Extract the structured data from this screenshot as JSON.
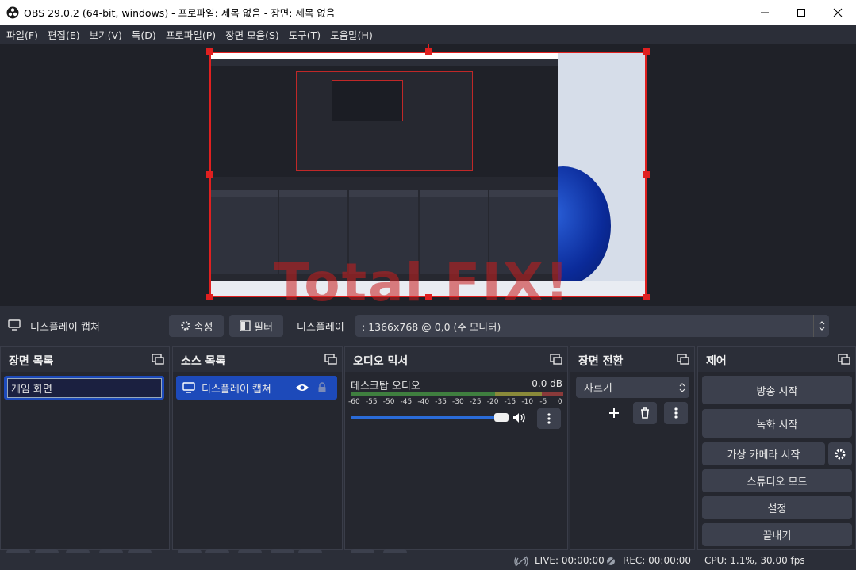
{
  "window": {
    "title": "OBS 29.0.2 (64-bit, windows) - 프로파일: 제목 없음 - 장면: 제목 없음"
  },
  "menu": [
    "파일(F)",
    "편집(E)",
    "보기(V)",
    "독(D)",
    "프로파일(P)",
    "장면 모음(S)",
    "도구(T)",
    "도움말(H)"
  ],
  "preview": {
    "watermark": "Total FIX!"
  },
  "source_toolbar": {
    "source_name": "디스플레이 캡쳐",
    "properties_label": "속성",
    "filters_label": "필터",
    "display_label": "디스플레이",
    "display_value": ": 1366x768 @ 0,0 (주 모니터)"
  },
  "scenes": {
    "title": "장면 목록",
    "items": [
      "게임 화면"
    ]
  },
  "sources": {
    "title": "소스 목록",
    "items": [
      "디스플레이 캡쳐"
    ]
  },
  "mixer": {
    "title": "오디오 믹서",
    "channel": "데스크탑 오디오",
    "level": "0.0 dB",
    "ticks": [
      "-60",
      "-55",
      "-50",
      "-45",
      "-40",
      "-35",
      "-30",
      "-25",
      "-20",
      "-15",
      "-10",
      "-5",
      "0"
    ],
    "volume": 1.0
  },
  "transitions": {
    "title": "장면 전환",
    "selected": "자르기"
  },
  "controls": {
    "title": "제어",
    "start_streaming": "방송 시작",
    "start_recording": "녹화 시작",
    "virtual_camera": "가상 카메라 시작",
    "studio_mode": "스튜디오 모드",
    "settings": "설정",
    "exit": "끝내기"
  },
  "status": {
    "live": "LIVE: 00:00:00",
    "rec": "REC: 00:00:00",
    "cpu": "CPU: 1.1%, 30.00 fps"
  },
  "colors": {
    "accent": "#1d4aba",
    "selection": "#e02020",
    "background": "#2b2e38"
  }
}
